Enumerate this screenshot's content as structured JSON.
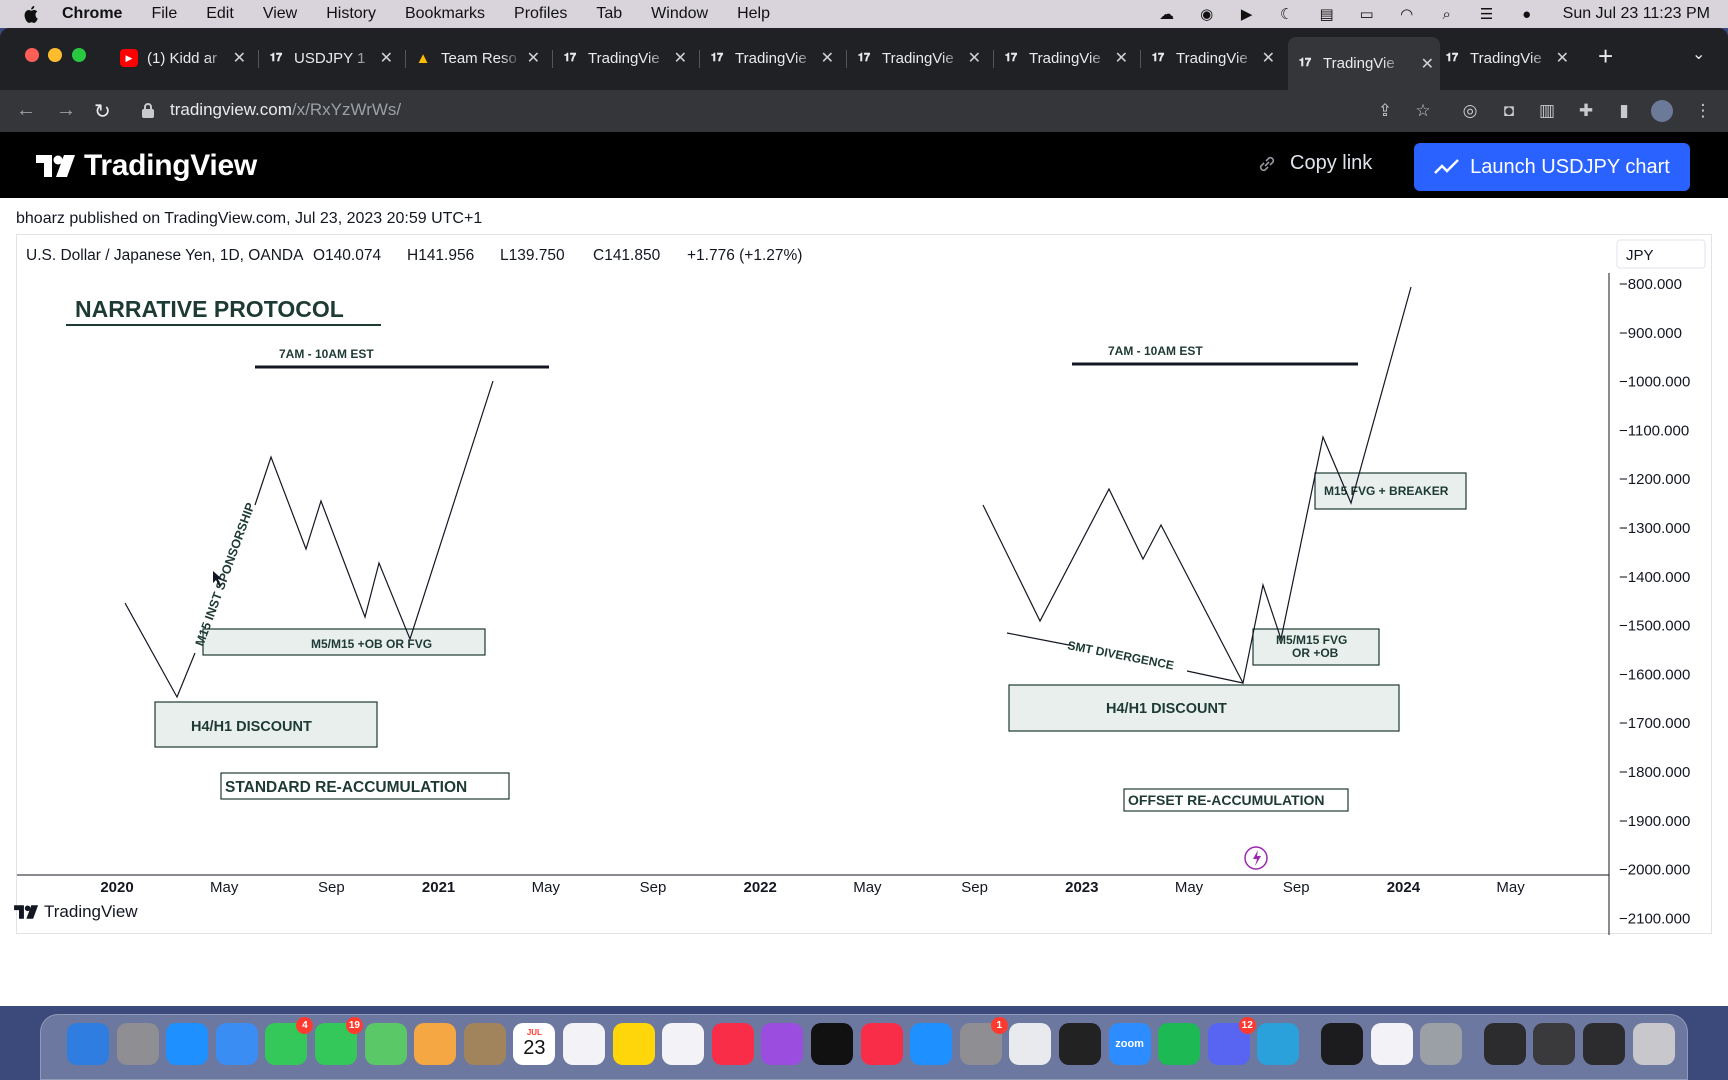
{
  "menubar": {
    "app_name": "Chrome",
    "items": [
      "File",
      "Edit",
      "View",
      "History",
      "Bookmarks",
      "Profiles",
      "Tab",
      "Window",
      "Help"
    ],
    "clock": "Sun Jul 23  11:23 PM"
  },
  "tabs": [
    {
      "title": "(1) Kidd ar",
      "icon": "youtube-icon"
    },
    {
      "title": "USDJPY 1",
      "icon": "tradingview-icon"
    },
    {
      "title": "Team Reso",
      "icon": "google-drive-icon"
    },
    {
      "title": "TradingVie",
      "icon": "tradingview-icon"
    },
    {
      "title": "TradingVie",
      "icon": "tradingview-icon"
    },
    {
      "title": "TradingVie",
      "icon": "tradingview-icon"
    },
    {
      "title": "TradingVie",
      "icon": "tradingview-icon"
    },
    {
      "title": "TradingVie",
      "icon": "tradingview-icon"
    },
    {
      "title": "TradingVie",
      "icon": "tradingview-icon"
    },
    {
      "title": "TradingVie",
      "icon": "tradingview-icon"
    }
  ],
  "active_tab": 8,
  "address": {
    "host": "tradingview.com",
    "path": "/x/RxYzWrWs/"
  },
  "header": {
    "logo_text": "TradingView",
    "copy_link": "Copy link",
    "launch_button": "Launch USDJPY chart",
    "brand_color": "#2962ff"
  },
  "publication": "bhoarz published on TradingView.com, Jul 23, 2023 20:59 UTC+1",
  "chart": {
    "legend": "U.S. Dollar / Japanese Yen, 1D, OANDA",
    "open": "O140.074",
    "high": "H141.956",
    "low": "L139.750",
    "close": "C141.850",
    "change": "+1.776 (+1.27%)",
    "currency": "JPY",
    "price_labels": [
      "−800.000",
      "−900.000",
      "−1000.000",
      "−1100.000",
      "−1200.000",
      "−1300.000",
      "−1400.000",
      "−1500.000",
      "−1600.000",
      "−1700.000",
      "−1800.000",
      "−1900.000",
      "−2000.000",
      "−2100.000"
    ],
    "time_labels": [
      {
        "text": "2020",
        "bold": true
      },
      {
        "text": "May",
        "bold": false
      },
      {
        "text": "Sep",
        "bold": false
      },
      {
        "text": "2021",
        "bold": true
      },
      {
        "text": "May",
        "bold": false
      },
      {
        "text": "Sep",
        "bold": false
      },
      {
        "text": "2022",
        "bold": true
      },
      {
        "text": "May",
        "bold": false
      },
      {
        "text": "Sep",
        "bold": false
      },
      {
        "text": "2023",
        "bold": true
      },
      {
        "text": "May",
        "bold": false
      },
      {
        "text": "Sep",
        "bold": false
      },
      {
        "text": "2024",
        "bold": true
      },
      {
        "text": "May",
        "bold": false
      }
    ],
    "annotations": {
      "title": "NARRATIVE PROTOCOL",
      "session_left": "7AM - 10AM EST",
      "session_right": "7AM - 10AM EST",
      "sponsorship": "M15 INST SPONSORSHIP",
      "left_entry_box": "M5/M15 +OB OR FVG",
      "left_discount_box": "H4/H1 DISCOUNT",
      "left_label": "STANDARD RE-ACCUMULATION",
      "smt": "SMT DIVERGENCE",
      "right_entry_box_line1": "M5/M15 FVG",
      "right_entry_box_line2": "OR +OB",
      "right_breaker_box": "M15 FVG + BREAKER",
      "right_discount_box": "H4/H1 DISCOUNT",
      "right_label": "OFFSET RE-ACCUMULATION"
    }
  },
  "footer": {
    "logo_text": "TradingView"
  },
  "dock": {
    "apps": [
      {
        "name": "finder-icon",
        "color": "#2f7de1"
      },
      {
        "name": "launchpad-icon",
        "color": "#8e8e93"
      },
      {
        "name": "safari-icon",
        "color": "#1e90ff"
      },
      {
        "name": "mail-icon",
        "color": "#3a8df3"
      },
      {
        "name": "facetime-icon",
        "color": "#34c759",
        "badge": "4"
      },
      {
        "name": "messages-icon",
        "color": "#34c759",
        "badge": "19"
      },
      {
        "name": "maps-icon",
        "color": "#5ac866"
      },
      {
        "name": "photos-icon",
        "color": "#f4a742"
      },
      {
        "name": "contacts-icon",
        "color": "#a1845c"
      },
      {
        "name": "calendar-icon",
        "color": "#ffffff"
      },
      {
        "name": "reminders-icon",
        "color": "#f2f2f7"
      },
      {
        "name": "notes-icon",
        "color": "#ffd60a"
      },
      {
        "name": "freeform-icon",
        "color": "#f2f2f7"
      },
      {
        "name": "music-icon",
        "color": "#fa2d48"
      },
      {
        "name": "podcasts-icon",
        "color": "#9b4de0"
      },
      {
        "name": "tv-icon",
        "color": "#111111"
      },
      {
        "name": "news-icon",
        "color": "#fa2d48"
      },
      {
        "name": "app-store-icon",
        "color": "#1e90ff"
      },
      {
        "name": "system-settings-icon",
        "color": "#8e8e93",
        "badge": "1"
      },
      {
        "name": "chrome-icon",
        "color": "#e8eaed"
      },
      {
        "name": "obs-icon",
        "color": "#222222"
      },
      {
        "name": "zoom-icon",
        "color": "#2d8cff"
      },
      {
        "name": "spotify-icon",
        "color": "#1db954"
      },
      {
        "name": "discord-icon",
        "color": "#5865f2",
        "badge": "12"
      },
      {
        "name": "telegram-icon",
        "color": "#2aa1da"
      },
      {
        "name": "activity-monitor-icon",
        "color": "#1c1c1e"
      },
      {
        "name": "textedit-icon",
        "color": "#f2f2f7"
      },
      {
        "name": "quicktime-icon",
        "color": "#9aa0a6"
      },
      {
        "name": "screenshot-thumbnail-1",
        "color": "#2c2c2e"
      },
      {
        "name": "screenshot-thumbnail-2",
        "color": "#3a3a3c"
      },
      {
        "name": "screenshot-thumbnail-3",
        "color": "#2c2c2e"
      },
      {
        "name": "trash-icon",
        "color": "#c7c7cc"
      }
    ],
    "calendar_month": "JUL",
    "calendar_day": "23",
    "zoom_label": "zoom"
  }
}
